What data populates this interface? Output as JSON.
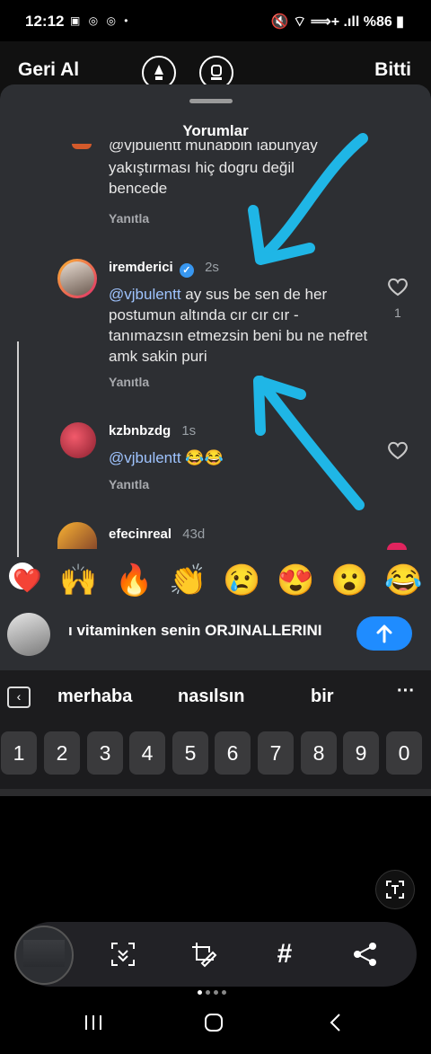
{
  "status_bar": {
    "time": "12:12",
    "status_icons": "▣ ◎ ◎ •",
    "right_icons": "🔇 ⌔ ⟹+ .ıll %86 ▮"
  },
  "edit_bar": {
    "undo_label": "Geri Al",
    "done_label": "Bitti"
  },
  "sheet": {
    "title": "Yorumlar",
    "comments": [
      {
        "partial_top": "@vjbulentt muhabbin labunyay",
        "text": "yakıştırması hiç dogru değil bencede",
        "reply": "Yanıtla"
      },
      {
        "user": "iremderici",
        "time": "2s",
        "mention": "@vjbulentt",
        "text": " ay sus be sen de her postumun altında cır cır cır - tanımazsın etmezsin beni bu ne nefret amk sakin puri",
        "reply": "Yanıtla",
        "likes": "1"
      },
      {
        "user": "kzbnbzdg",
        "time": "1s",
        "mention": "@vjbulentt",
        "text": " 😂😂",
        "reply": "Yanıtla"
      },
      {
        "user": "efecinreal",
        "time": "43d"
      }
    ],
    "emojis": [
      "❤️",
      "🙌",
      "🔥",
      "👏",
      "😢",
      "😍",
      "😮",
      "😂"
    ]
  },
  "input": {
    "text": "ı vitaminken senin ORJINALLERINI"
  },
  "keyboard": {
    "suggestions": [
      "merhaba",
      "nasılsın",
      "bir"
    ],
    "keys": [
      "1",
      "2",
      "3",
      "4",
      "5",
      "6",
      "7",
      "8",
      "9",
      "0"
    ]
  },
  "colors": {
    "sheet_bg": "#2d2f33",
    "accent": "#1f8cff",
    "mention": "#9fc4ff",
    "annotation": "#1fb6e6"
  }
}
